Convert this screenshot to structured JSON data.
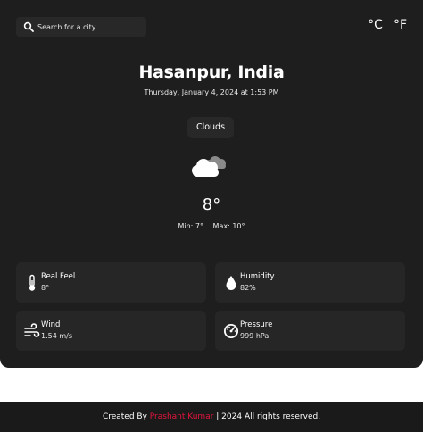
{
  "search": {
    "placeholder": "Search for a city...",
    "icon": "search-icon"
  },
  "units": {
    "celsius": "°C",
    "fahrenheit": "°F"
  },
  "location": {
    "city": "Hasanpur, India",
    "datetime": "Thursday, January 4, 2024 at 1:53 PM"
  },
  "weather": {
    "condition": "Clouds",
    "icon": "cloud-icon",
    "temperature": "8°",
    "min": "Min: 7°",
    "max": "Max: 10°"
  },
  "details": {
    "real_feel": {
      "label": "Real Feel",
      "value": "8°",
      "icon": "thermometer-icon"
    },
    "humidity": {
      "label": "Humidity",
      "value": "82%",
      "icon": "droplet-icon"
    },
    "wind": {
      "label": "Wind",
      "value": "1.54 m/s",
      "icon": "wind-icon"
    },
    "pressure": {
      "label": "Pressure",
      "value": "999 hPa",
      "icon": "gauge-icon"
    }
  },
  "footer": {
    "prefix": "Created By ",
    "author": "Prashant Kumar",
    "suffix": " | 2024 All rights reserved."
  },
  "colors": {
    "background": "#1e1e1e",
    "card": "#262626",
    "author_accent": "#e4143c"
  }
}
